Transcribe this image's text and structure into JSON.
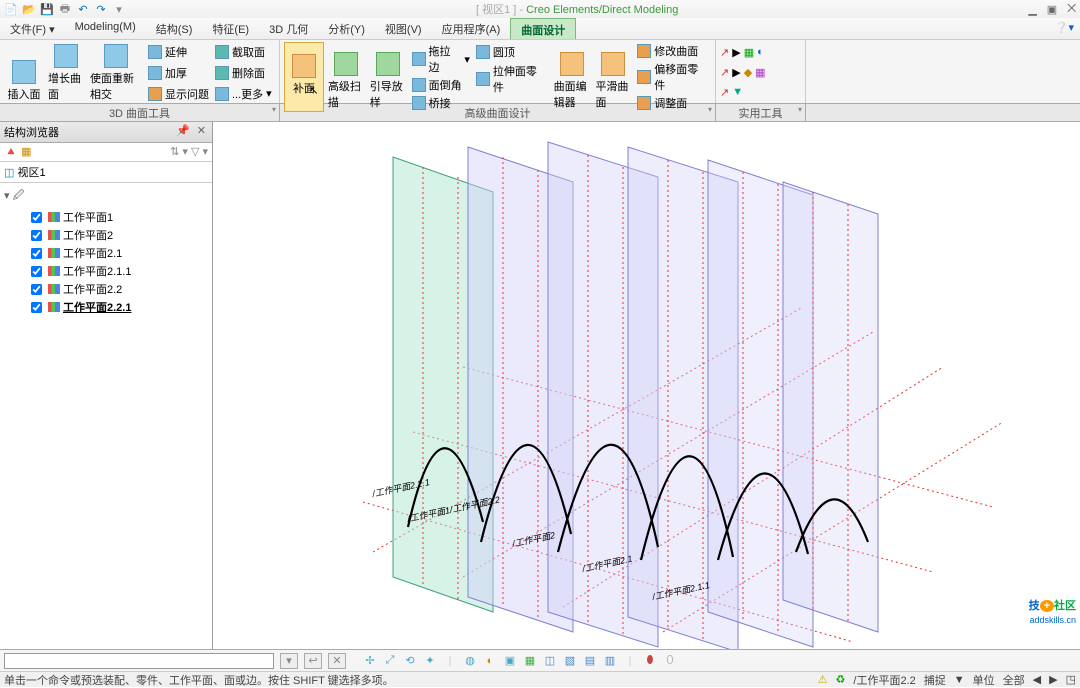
{
  "window": {
    "title_prefix": "[ 视区1 ] -",
    "title_app": "Creo Elements/Direct Modeling"
  },
  "menu": {
    "file": "文件(F)",
    "modeling": "Modeling(M)",
    "structure": "结构(S)",
    "feature": "特征(E)",
    "geom": "3D 几何",
    "analysis": "分析(Y)",
    "view": "视图(V)",
    "app": "应用程序(A)",
    "surface": "曲面设计"
  },
  "ribbon": {
    "insert_face": "插入面",
    "extend_surf": "增长曲面",
    "reintersect": "使面重新相交",
    "extend": "延伸",
    "thicken": "加厚",
    "show_issue": "显示问题",
    "extract": "截取面",
    "delete_face": "删除面",
    "more": "...更多",
    "patch": "补面",
    "adv_sweep": "高级扫描",
    "guide": "引导放样",
    "drag_edge": "拖拉边",
    "fillet": "圆顶",
    "face_body": "面倒角",
    "stretch_part": "拉伸面零件",
    "bridge": "桥接",
    "surf_editor": "曲面编辑器",
    "smooth": "平滑曲面",
    "modify_surf": "修改曲面",
    "offset_part": "偏移面零件",
    "adjust_face": "调整面",
    "group1": "3D 曲面工具",
    "group2": "高级曲面设计",
    "group3": "实用工具"
  },
  "sidebar": {
    "title": "结构浏览器",
    "view_label": "视区1",
    "items": [
      {
        "label": "工作平面1"
      },
      {
        "label": "工作平面2"
      },
      {
        "label": "工作平面2.1"
      },
      {
        "label": "工作平面2.1.1"
      },
      {
        "label": "工作平面2.2"
      },
      {
        "label": "工作平面2.2.1"
      }
    ]
  },
  "viewport_labels": {
    "p1": "/工作平面2.2.1",
    "p2": "/工作平面1/工作平面2.2",
    "p3": "/工作平面2",
    "p4": "/工作平面2.1",
    "p5": "/工作平面2.1.1"
  },
  "status": {
    "hint": "单击一个命令或预选装配、零件、工作平面、面或边。按住 SHIFT 键选择多项。",
    "wp": "/工作平面2.2",
    "catch": "捕捉",
    "unit": "单位",
    "all": "全部"
  },
  "watermark": {
    "t1": "技",
    "t2": "社区",
    "url": "addskills.cn"
  }
}
